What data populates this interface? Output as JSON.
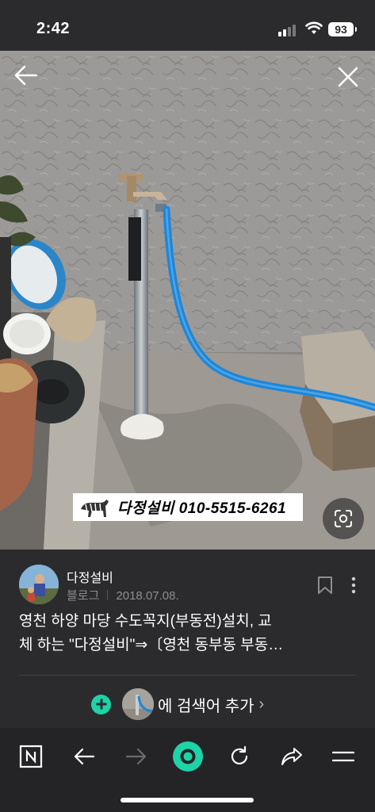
{
  "status_bar": {
    "time": "2:42",
    "battery": "93"
  },
  "photo": {
    "watermark_text": "다정설비  010-5515-6261"
  },
  "post": {
    "blog_name": "다정설비",
    "source": "블로그",
    "date": "2018.07.08.",
    "title_line1": "영천 하양 마당 수도꼭지(부동전)설치, 교",
    "title_line2": "체 하는 \"다정설비\"⇒〔영천 동부동 부동…"
  },
  "add_search": {
    "label": "에 검색어 추가",
    "chevron": "›"
  },
  "colors": {
    "accent": "#1dd3a7",
    "background": "#2b2b2d",
    "toolbar": "#242426"
  },
  "icons": [
    "back-arrow-icon",
    "close-icon",
    "lens-icon",
    "bookmark-icon",
    "more-icon",
    "naver-n-icon",
    "nav-back-icon",
    "nav-forward-icon",
    "green-dot-icon",
    "refresh-icon",
    "share-icon",
    "menu-icon"
  ]
}
